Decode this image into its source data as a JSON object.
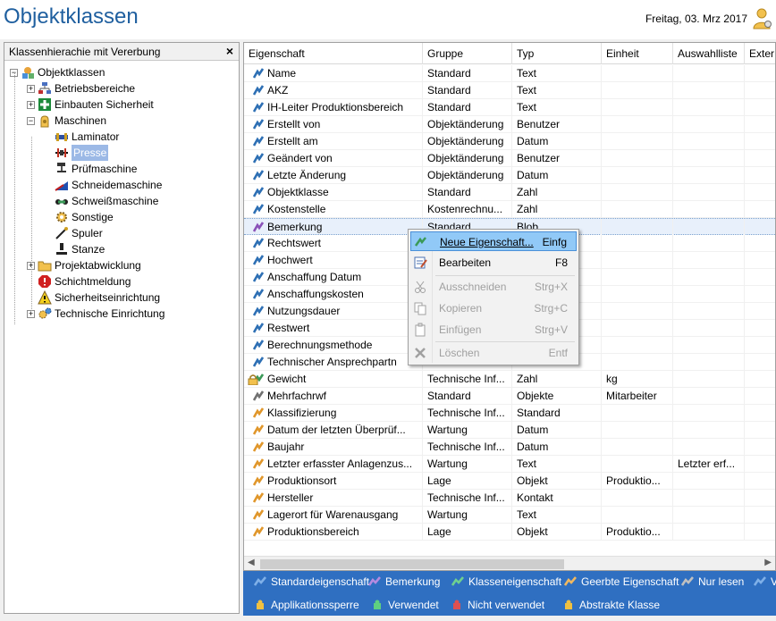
{
  "app": {
    "title": "Objektklassen",
    "date": "Freitag, 03. Mrz 2017"
  },
  "left_panel": {
    "header": "Klassenhierachie mit Vererbung",
    "close_label": "×",
    "tree": [
      {
        "label": "Objektklassen",
        "icon": "class-root-icon"
      },
      {
        "label": "Betriebsbereiche",
        "icon": "org-chart-icon"
      },
      {
        "label": "Einbauten Sicherheit",
        "icon": "first-aid-icon"
      },
      {
        "label": "Maschinen",
        "icon": "machine-hand-icon"
      },
      {
        "label": "Laminator",
        "icon": "laminator-icon"
      },
      {
        "label": "Presse",
        "icon": "press-icon"
      },
      {
        "label": "Prüfmaschine",
        "icon": "test-machine-icon"
      },
      {
        "label": "Schneidemaschine",
        "icon": "cutter-icon"
      },
      {
        "label": "Schweißmaschine",
        "icon": "welder-icon"
      },
      {
        "label": "Sonstige",
        "icon": "gear-icon"
      },
      {
        "label": "Spuler",
        "icon": "spooler-icon"
      },
      {
        "label": "Stanze",
        "icon": "punch-icon"
      },
      {
        "label": "Projektabwicklung",
        "icon": "folder-icon"
      },
      {
        "label": "Schichtmeldung",
        "icon": "alert-icon"
      },
      {
        "label": "Sicherheitseinrichtung",
        "icon": "warning-icon"
      },
      {
        "label": "Technische Einrichtung",
        "icon": "gears-icon"
      }
    ]
  },
  "grid": {
    "columns": [
      "Eigenschaft",
      "Gruppe",
      "Typ",
      "Einheit",
      "Auswahlliste",
      "Exter"
    ],
    "rows": [
      {
        "name": "Name",
        "gruppe": "Standard",
        "typ": "Text",
        "einheit": "",
        "auswahl": "",
        "color": "#2d6fb4"
      },
      {
        "name": "AKZ",
        "gruppe": "Standard",
        "typ": "Text",
        "einheit": "",
        "auswahl": "",
        "color": "#2d6fb4"
      },
      {
        "name": "IH-Leiter Produktionsbereich",
        "gruppe": "Standard",
        "typ": "Text",
        "einheit": "",
        "auswahl": "",
        "color": "#2d6fb4"
      },
      {
        "name": "Erstellt von",
        "gruppe": "Objektänderung",
        "typ": "Benutzer",
        "einheit": "",
        "auswahl": "",
        "color": "#2d6fb4"
      },
      {
        "name": "Erstellt am",
        "gruppe": "Objektänderung",
        "typ": "Datum",
        "einheit": "",
        "auswahl": "",
        "color": "#2d6fb4"
      },
      {
        "name": "Geändert von",
        "gruppe": "Objektänderung",
        "typ": "Benutzer",
        "einheit": "",
        "auswahl": "",
        "color": "#2d6fb4"
      },
      {
        "name": "Letzte Änderung",
        "gruppe": "Objektänderung",
        "typ": "Datum",
        "einheit": "",
        "auswahl": "",
        "color": "#2d6fb4"
      },
      {
        "name": "Objektklasse",
        "gruppe": "Standard",
        "typ": "Zahl",
        "einheit": "",
        "auswahl": "",
        "color": "#2d6fb4"
      },
      {
        "name": "Kostenstelle",
        "gruppe": "Kostenrechnu...",
        "typ": "Zahl",
        "einheit": "",
        "auswahl": "",
        "color": "#2d6fb4"
      },
      {
        "name": "Bemerkung",
        "gruppe": "Standard",
        "typ": "Blob",
        "einheit": "",
        "auswahl": "",
        "color": "#8a52b8"
      },
      {
        "name": "Rechtswert",
        "gruppe": "",
        "typ": "",
        "einheit": "",
        "auswahl": "",
        "color": "#2d6fb4"
      },
      {
        "name": "Hochwert",
        "gruppe": "",
        "typ": "",
        "einheit": "",
        "auswahl": "",
        "color": "#2d6fb4"
      },
      {
        "name": "Anschaffung Datum",
        "gruppe": "",
        "typ": "",
        "einheit": "",
        "auswahl": "",
        "color": "#2d6fb4"
      },
      {
        "name": "Anschaffungskosten",
        "gruppe": "",
        "typ": "",
        "einheit": "",
        "auswahl": "",
        "color": "#2d6fb4"
      },
      {
        "name": "Nutzungsdauer",
        "gruppe": "",
        "typ": "",
        "einheit": "",
        "auswahl": "",
        "color": "#2d6fb4"
      },
      {
        "name": "Restwert",
        "gruppe": "",
        "typ": "",
        "einheit": "",
        "auswahl": "",
        "color": "#2d6fb4"
      },
      {
        "name": "Berechnungsmethode",
        "gruppe": "",
        "typ": "",
        "einheit": "",
        "auswahl": "",
        "color": "#2d6fb4"
      },
      {
        "name": "Technischer Ansprechpartn",
        "gruppe": "",
        "typ": "",
        "einheit": "",
        "auswahl": "",
        "color": "#2d6fb4"
      },
      {
        "name": "Gewicht",
        "gruppe": "Technische Inf...",
        "typ": "Zahl",
        "einheit": "kg",
        "auswahl": "",
        "color": "#3a9a58"
      },
      {
        "name": "Mehrfachrwf",
        "gruppe": "Standard",
        "typ": "Objekte",
        "einheit": "Mitarbeiter",
        "auswahl": "",
        "color": "#707070"
      },
      {
        "name": "Klassifizierung",
        "gruppe": "Technische Inf...",
        "typ": "Standard",
        "einheit": "",
        "auswahl": "",
        "color": "#e0962a"
      },
      {
        "name": "Datum der letzten Überprüf...",
        "gruppe": "Wartung",
        "typ": "Datum",
        "einheit": "",
        "auswahl": "",
        "color": "#e0962a"
      },
      {
        "name": "Baujahr",
        "gruppe": "Technische Inf...",
        "typ": "Datum",
        "einheit": "",
        "auswahl": "",
        "color": "#e0962a"
      },
      {
        "name": "Letzter erfasster Anlagenzus...",
        "gruppe": "Wartung",
        "typ": "Text",
        "einheit": "",
        "auswahl": "Letzter erf...",
        "color": "#e0962a"
      },
      {
        "name": "Produktionsort",
        "gruppe": "Lage",
        "typ": "Objekt",
        "einheit": "Produktio...",
        "auswahl": "",
        "color": "#e0962a"
      },
      {
        "name": "Hersteller",
        "gruppe": "Technische Inf...",
        "typ": "Kontakt",
        "einheit": "",
        "auswahl": "",
        "color": "#e0962a"
      },
      {
        "name": "Lagerort für Warenausgang",
        "gruppe": "Wartung",
        "typ": "Text",
        "einheit": "",
        "auswahl": "",
        "color": "#e0962a"
      },
      {
        "name": "Produktionsbereich",
        "gruppe": "Lage",
        "typ": "Objekt",
        "einheit": "Produktio...",
        "auswahl": "",
        "color": "#e0962a"
      }
    ]
  },
  "context_menu": {
    "items": [
      {
        "label": "Neue Eigenschaft...",
        "shortcut": "Einfg",
        "enabled": true
      },
      {
        "label": "Bearbeiten",
        "shortcut": "F8",
        "enabled": true
      },
      {
        "label": "Ausschneiden",
        "shortcut": "Strg+X",
        "enabled": false
      },
      {
        "label": "Kopieren",
        "shortcut": "Strg+C",
        "enabled": false
      },
      {
        "label": "Einfügen",
        "shortcut": "Strg+V",
        "enabled": false
      },
      {
        "label": "Löschen",
        "shortcut": "Entf",
        "enabled": false
      }
    ]
  },
  "legend": {
    "items": [
      {
        "label": "Standardeigenschaft",
        "color": "#7fb0e8"
      },
      {
        "label": "Bemerkung",
        "color": "#b58ae0"
      },
      {
        "label": "Klasseneigenschaft",
        "color": "#6fd08f"
      },
      {
        "label": "Geerbte Eigenschaft",
        "color": "#f0b860"
      },
      {
        "label": "Nur lesen",
        "color": "#c0c0c0"
      },
      {
        "label": "V",
        "color": "#7fb0e8"
      },
      {
        "label": "Applikationssperre",
        "color": "#f0c040"
      },
      {
        "label": "Verwendet",
        "color": "#5fd080"
      },
      {
        "label": "Nicht verwendet",
        "color": "#e05050"
      },
      {
        "label": "Abstrakte Klasse",
        "color": "#f0c040"
      }
    ]
  }
}
